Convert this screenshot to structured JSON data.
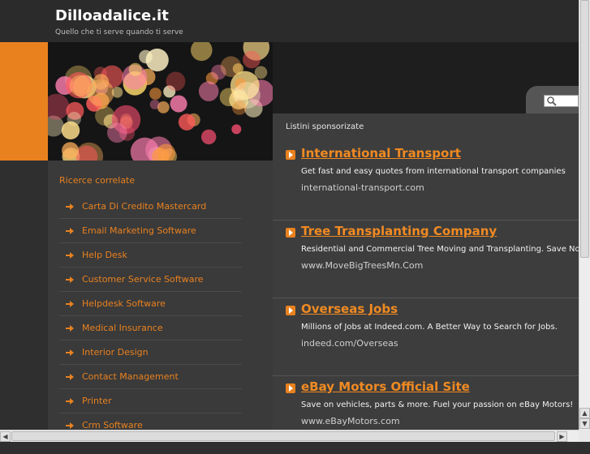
{
  "header": {
    "site_title": "Dilloadalice.it",
    "tagline": "Quello che ti serve quando ti serve"
  },
  "search": {
    "icon": "search-icon"
  },
  "related": {
    "title": "Ricerce correlate",
    "items": [
      {
        "label": "Carta Di Credito Mastercard"
      },
      {
        "label": "Email Marketing Software"
      },
      {
        "label": "Help Desk"
      },
      {
        "label": "Customer Service Software"
      },
      {
        "label": "Helpdesk Software"
      },
      {
        "label": "Medical Insurance"
      },
      {
        "label": "Interior Design"
      },
      {
        "label": "Contact Management"
      },
      {
        "label": "Printer"
      },
      {
        "label": "Crm Software"
      }
    ]
  },
  "sponsored": {
    "heading": "Listini sponsorizate",
    "listings": [
      {
        "title": "International Transport",
        "desc": "Get fast and easy quotes from international transport companies",
        "url": "international-transport.com"
      },
      {
        "title": "Tree Transplanting Company",
        "desc": "Residential and Commercial Tree Moving and Transplanting. Save Now.",
        "url": "www.MoveBigTreesMn.Com"
      },
      {
        "title": "Overseas Jobs",
        "desc": "Millions of Jobs at Indeed.com. A Better Way to Search for Jobs.",
        "url": "indeed.com/Overseas"
      },
      {
        "title": "eBay Motors Official Site",
        "desc": "Save on vehicles, parts & more. Fuel your passion on eBay Motors!",
        "url": "www.eBayMotors.com"
      }
    ]
  },
  "colors": {
    "accent": "#e9811f",
    "background": "#2f2f2f",
    "panel": "#3d3d3d"
  }
}
